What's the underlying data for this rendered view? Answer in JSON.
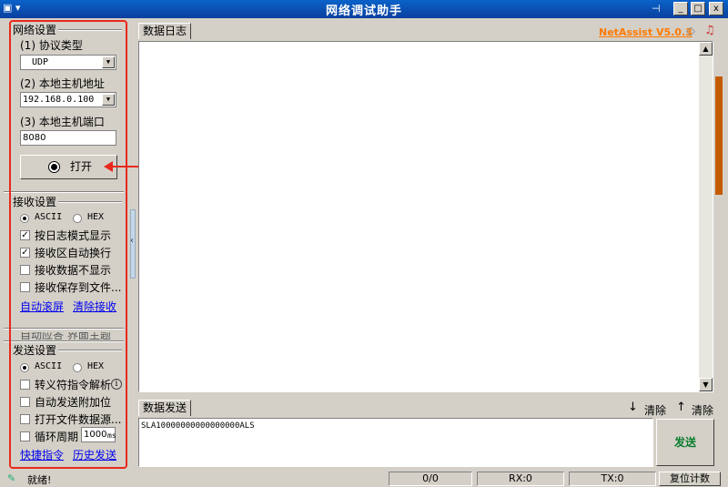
{
  "window": {
    "title": "网络调试助手",
    "pin_icon": "pin-icon",
    "min_label": "_",
    "max_label": "□",
    "close_label": "x"
  },
  "network": {
    "group_title": "网络设置",
    "protocol_label": "(1) 协议类型",
    "protocol_value": "UDP",
    "host_label": "(2) 本地主机地址",
    "host_value": "192.168.0.100",
    "port_label": "(3) 本地主机端口",
    "port_value": "8080",
    "open_button": "打开"
  },
  "receive": {
    "group_title": "接收设置",
    "ascii": "ASCII",
    "hex": "HEX",
    "options": [
      {
        "label": "按日志模式显示",
        "checked": true
      },
      {
        "label": "接收区自动换行",
        "checked": true
      },
      {
        "label": "接收数据不显示",
        "checked": false
      },
      {
        "label": "接收保存到文件...",
        "checked": false
      }
    ],
    "auto_scroll_link": "自动滚屏",
    "clear_link": "清除接收"
  },
  "hidden_group": {
    "title": "自动应答  界面主题"
  },
  "send": {
    "group_title": "发送设置",
    "ascii": "ASCII",
    "hex": "HEX",
    "options": [
      {
        "label": "转义符指令解析",
        "checked": false
      },
      {
        "label": "自动发送附加位",
        "checked": false
      },
      {
        "label": "打开文件数据源...",
        "checked": false
      },
      {
        "label": "循环周期",
        "checked": false
      }
    ],
    "cycle_value": "1000",
    "cycle_unit": "ms",
    "shortcut_link": "快捷指令",
    "history_link": "历史发送"
  },
  "log": {
    "tab_label": "数据日志",
    "brand": "NetAssist V5.0.3"
  },
  "send_area": {
    "tab_label": "数据发送",
    "clear1": "清除",
    "clear2": "清除",
    "content": "SLA10000000000000000ALS",
    "send_button": "发送"
  },
  "status": {
    "text": "就绪!",
    "count": "0/0",
    "rx": "RX:0",
    "tx": "TX:0",
    "reset": "复位计数"
  },
  "colors": {
    "accent_red": "#e8291c",
    "brand_orange": "#ff7a00",
    "title_blue": "#0a54b8"
  }
}
